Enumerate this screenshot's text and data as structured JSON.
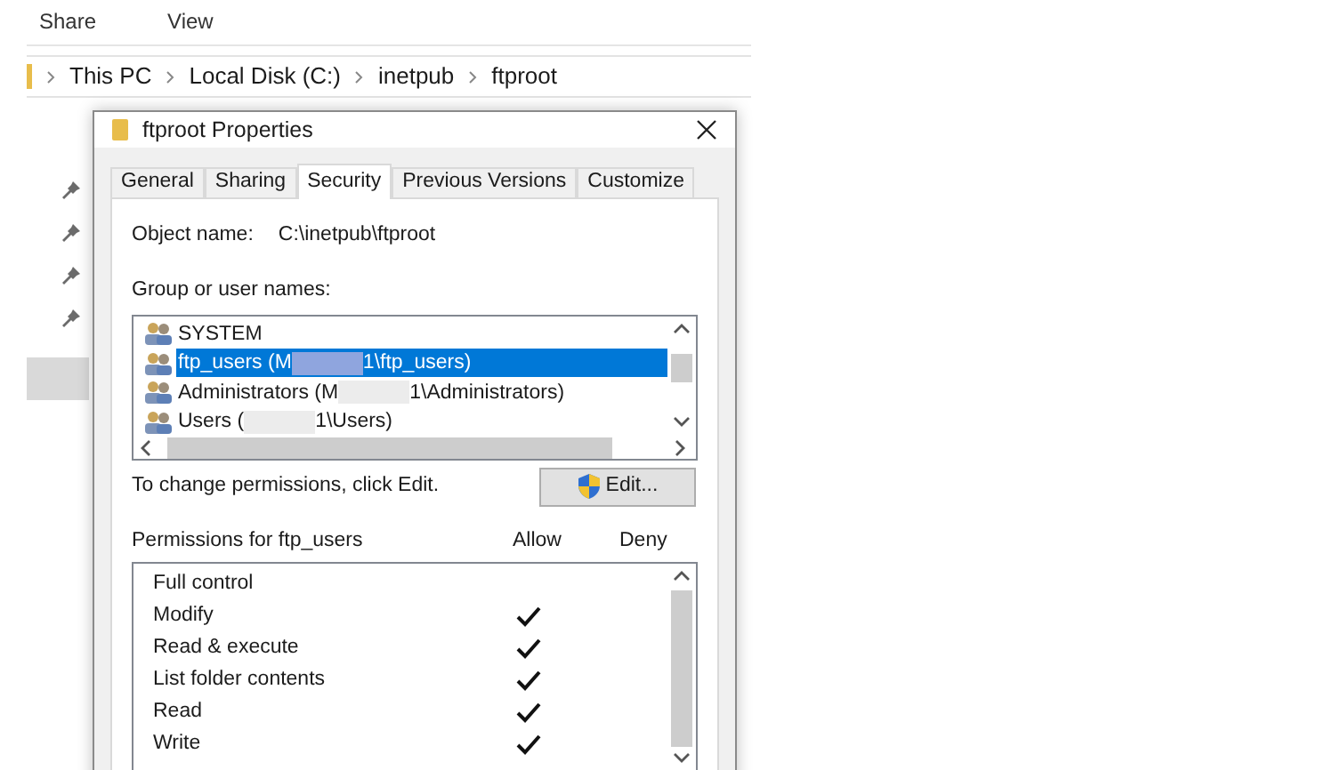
{
  "ribbon": {
    "tabs": [
      "Share",
      "View"
    ]
  },
  "address_bar": {
    "crumbs": [
      "This PC",
      "Local Disk (C:)",
      "inetpub",
      "ftproot"
    ]
  },
  "dialog": {
    "title": "ftproot Properties",
    "tabs": [
      {
        "label": "General",
        "selected": false
      },
      {
        "label": "Sharing",
        "selected": false
      },
      {
        "label": "Security",
        "selected": true
      },
      {
        "label": "Previous Versions",
        "selected": false
      },
      {
        "label": "Customize",
        "selected": false
      }
    ],
    "object_name": {
      "label": "Object name:",
      "value": "C:\\inetpub\\ftproot"
    },
    "groups_label": "Group or user names:",
    "groups": [
      {
        "parts": [
          "SYSTEM"
        ],
        "selected": false
      },
      {
        "parts": [
          "ftp_users (M",
          "1\\ftp_users)"
        ],
        "selected": true
      },
      {
        "parts": [
          "Administrators (M",
          "1\\Administrators)"
        ],
        "selected": false
      },
      {
        "parts": [
          "Users (",
          "1\\Users)"
        ],
        "selected": false
      }
    ],
    "change_hint": "To change permissions, click Edit.",
    "edit_button": "Edit...",
    "permissions_label": "Permissions for ftp_users",
    "allow_header": "Allow",
    "deny_header": "Deny",
    "permissions": [
      {
        "name": "Full control",
        "allow": false
      },
      {
        "name": "Modify",
        "allow": true
      },
      {
        "name": "Read & execute",
        "allow": true
      },
      {
        "name": "List folder contents",
        "allow": true
      },
      {
        "name": "Read",
        "allow": true
      },
      {
        "name": "Write",
        "allow": true
      }
    ]
  }
}
